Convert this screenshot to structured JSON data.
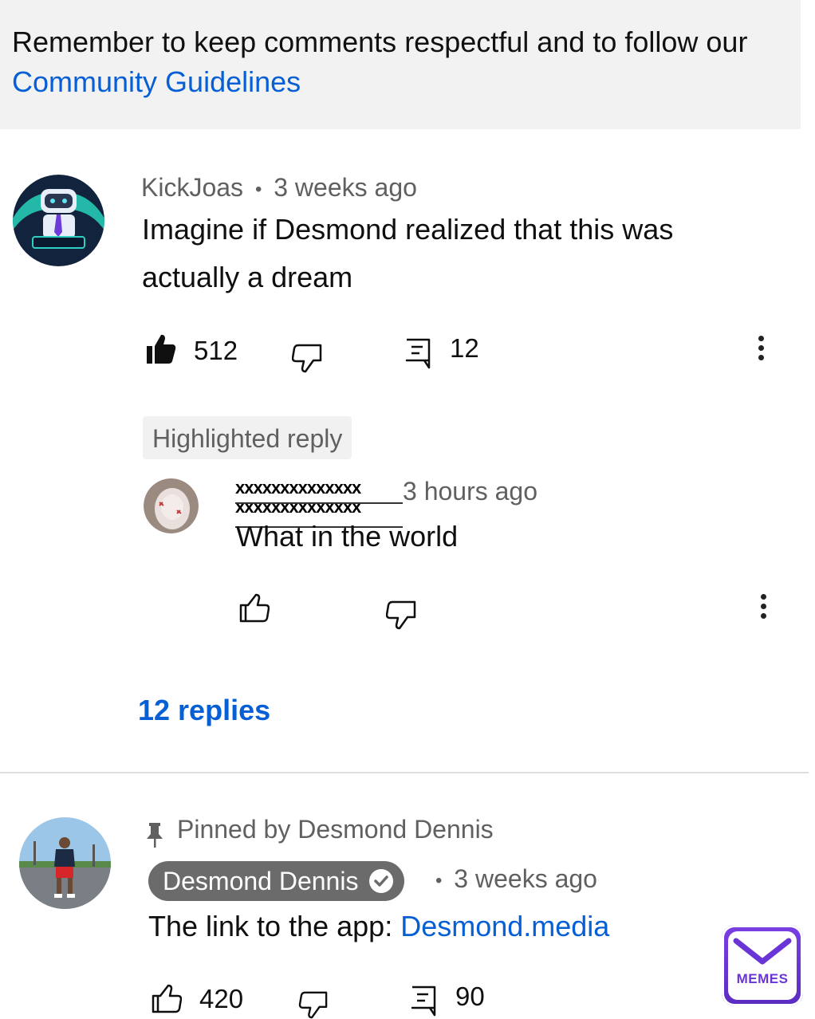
{
  "banner": {
    "text": "Remember to keep comments respectful and to follow our ",
    "link": "Community Guidelines"
  },
  "comment1": {
    "author": "KickJoas",
    "separator": "•",
    "time": "3 weeks ago",
    "text": "Imagine if Desmond realized that this was actually a dream",
    "likes": "512",
    "replies_count": "12",
    "highlighted_label": "Highlighted reply",
    "reply": {
      "author_redacted_1": "xxxxxxxxxxxxxx",
      "author_redacted_2": "xxxxxxxxxxxxxx",
      "time": "3 hours ago",
      "text": "What in the world"
    },
    "replies_link": "12 replies"
  },
  "comment2": {
    "pinned": "Pinned by Desmond Dennis",
    "author": "Desmond Dennis",
    "separator": "•",
    "time": "3 weeks ago",
    "text_prefix": "The link to the app: ",
    "link": "Desmond.media",
    "likes": "420",
    "replies_count": "90"
  },
  "watermark": {
    "text": "MEMES"
  },
  "colors": {
    "link": "#065fd4",
    "meta": "#606060",
    "banner_bg": "#f2f2f2",
    "memes_purple": "#6a35d6"
  }
}
